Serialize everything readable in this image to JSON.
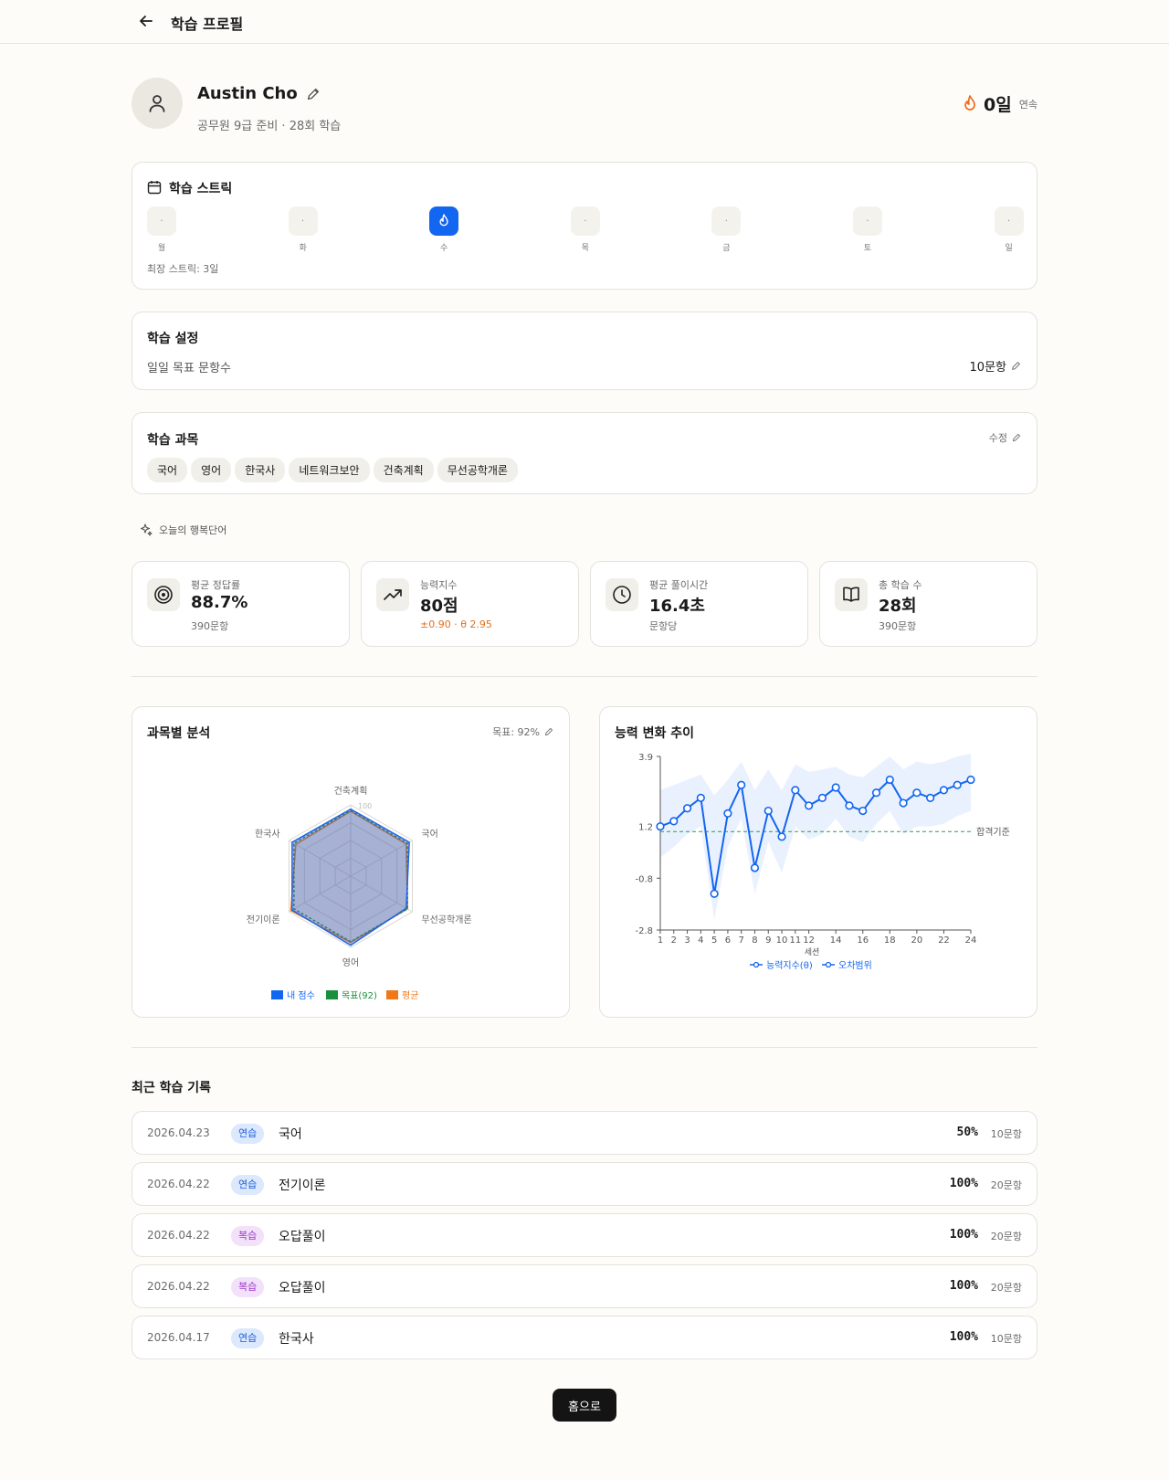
{
  "header": {
    "title": "학습 프로필"
  },
  "profile": {
    "name": "Austin Cho",
    "subtitle": "공무원 9급 준비 · 28회 학습",
    "streak_value": "0일",
    "streak_label": "연속"
  },
  "streak_card": {
    "title": "학습 스트릭",
    "days": [
      {
        "label": "월",
        "mark": "·",
        "active": false
      },
      {
        "label": "화",
        "mark": "·",
        "active": false
      },
      {
        "label": "수",
        "mark": "",
        "active": true
      },
      {
        "label": "목",
        "mark": "·",
        "active": false
      },
      {
        "label": "금",
        "mark": "·",
        "active": false
      },
      {
        "label": "토",
        "mark": "·",
        "active": false
      },
      {
        "label": "일",
        "mark": "·",
        "active": false
      }
    ],
    "longest": "최장 스트릭: 3일"
  },
  "settings": {
    "title": "학습 설정",
    "goal_label": "일일 목표 문항수",
    "goal_value": "10문항"
  },
  "subjects": {
    "title": "학습 과목",
    "edit_label": "수정",
    "items": [
      "국어",
      "영어",
      "한국사",
      "네트워크보안",
      "건축계획",
      "무선공학개론"
    ]
  },
  "happy_word": {
    "label": "오늘의 행복단어"
  },
  "stats": [
    {
      "label": "평균 정답률",
      "value": "88.7%",
      "sub": "390문항",
      "icon": "target-icon"
    },
    {
      "label": "능력지수",
      "value": "80점",
      "sub": "±0.90 · θ 2.95",
      "icon": "trending-up-icon"
    },
    {
      "label": "평균 풀이시간",
      "value": "16.4초",
      "sub": "문항당",
      "icon": "clock-icon"
    },
    {
      "label": "총 학습 수",
      "value": "28회",
      "sub": "390문항",
      "icon": "book-icon"
    }
  ],
  "colors": {
    "accent": "#1366f0",
    "streak": "#f26a1b",
    "goal": "#1a8f3c",
    "avg": "#f07818",
    "sub_orange": "#e0701c"
  },
  "chart_data": [
    {
      "type": "radar",
      "title": "과목별 분석",
      "goal_label": "목표: 92%",
      "categories": [
        "건축계획",
        "국어",
        "무선공학개론",
        "영어",
        "전기이론",
        "한국사"
      ],
      "range": [
        0,
        100
      ],
      "center_label": "100",
      "series": [
        {
          "name": "내 점수",
          "values": [
            94,
            95,
            90,
            97,
            95,
            95
          ],
          "color": "#1366f0"
        },
        {
          "name": "목표(92)",
          "values": [
            92,
            92,
            92,
            92,
            92,
            92
          ],
          "color": "#1a8f3c"
        },
        {
          "name": "평균",
          "values": [
            91,
            90,
            92,
            93,
            97,
            89
          ],
          "color": "#f07818"
        }
      ]
    },
    {
      "type": "line",
      "title": "능력 변화 추이",
      "xlabel": "세션",
      "x": [
        1,
        2,
        3,
        4,
        5,
        6,
        7,
        8,
        9,
        10,
        11,
        12,
        13,
        14,
        15,
        16,
        17,
        18,
        19,
        20,
        21,
        22,
        23,
        24
      ],
      "x_ticks": [
        1,
        2,
        3,
        4,
        5,
        6,
        7,
        8,
        9,
        10,
        11,
        12,
        14,
        16,
        18,
        20,
        22,
        24
      ],
      "y_ticks": [
        3.9,
        1.2,
        -0.8,
        -2.8
      ],
      "ylim": [
        -2.8,
        3.9
      ],
      "threshold": {
        "value": 1.0,
        "label": "합격기준"
      },
      "series": [
        {
          "name": "능력지수(θ)",
          "values": [
            1.2,
            1.4,
            1.9,
            2.3,
            -1.4,
            1.7,
            2.8,
            -0.4,
            1.8,
            0.8,
            2.6,
            2.0,
            2.3,
            2.7,
            2.0,
            1.8,
            2.5,
            3.0,
            2.1,
            2.5,
            2.3,
            2.6,
            2.8,
            3.0
          ]
        },
        {
          "name": "오차범위",
          "upper": [
            2.6,
            2.8,
            3.0,
            3.2,
            2.4,
            3.0,
            3.7,
            2.6,
            3.4,
            2.6,
            3.6,
            3.3,
            3.4,
            3.5,
            3.2,
            3.1,
            3.5,
            3.9,
            3.4,
            3.7,
            3.6,
            3.7,
            3.9,
            4.0
          ],
          "lower": [
            0.0,
            0.4,
            0.9,
            1.2,
            -2.4,
            0.4,
            1.5,
            -1.4,
            0.6,
            -0.6,
            1.2,
            0.7,
            0.9,
            1.5,
            0.8,
            0.6,
            1.3,
            1.8,
            0.9,
            1.2,
            1.2,
            1.3,
            1.6,
            1.8
          ]
        }
      ]
    }
  ],
  "recent": {
    "title": "최근 학습 기록",
    "items": [
      {
        "date": "2026.04.23",
        "type": "연습",
        "kind": "practice",
        "subject": "국어",
        "percent": "50%",
        "count": "10문항"
      },
      {
        "date": "2026.04.22",
        "type": "연습",
        "kind": "practice",
        "subject": "전기이론",
        "percent": "100%",
        "count": "20문항"
      },
      {
        "date": "2026.04.22",
        "type": "복습",
        "kind": "review",
        "subject": "오답풀이",
        "percent": "100%",
        "count": "20문항"
      },
      {
        "date": "2026.04.22",
        "type": "복습",
        "kind": "review",
        "subject": "오답풀이",
        "percent": "100%",
        "count": "20문항"
      },
      {
        "date": "2026.04.17",
        "type": "연습",
        "kind": "practice",
        "subject": "한국사",
        "percent": "100%",
        "count": "10문항"
      }
    ]
  },
  "home_button": "홈으로"
}
